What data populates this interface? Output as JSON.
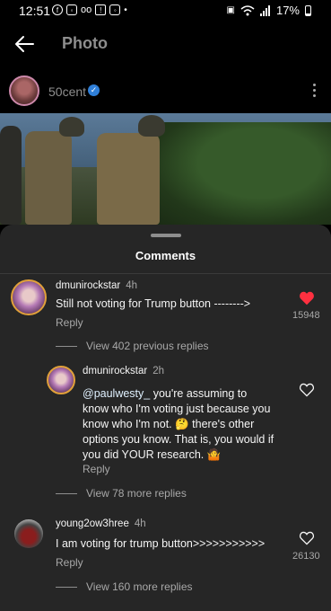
{
  "status_bar": {
    "time": "12:51",
    "battery": "17%"
  },
  "header": {
    "title": "Photo"
  },
  "post": {
    "author": "50cent"
  },
  "comments_sheet": {
    "title": "Comments",
    "comments": [
      {
        "username": "dmunirockstar",
        "time": "4h",
        "text": "Still not voting for Trump button -------->",
        "reply_label": "Reply",
        "likes": "15948",
        "liked": true,
        "view_replies": "View 402 previous replies"
      },
      {
        "username": "dmunirockstar",
        "time": "2h",
        "mention": "@paulwesty_",
        "text": " you're assuming to know who I'm voting just because you know who I'm not. 🤔 there's other options you know. That is, you would if you did YOUR research. 🤷",
        "reply_label": "Reply",
        "view_replies": "View 78 more replies"
      },
      {
        "username": "young2ow3hree",
        "time": "4h",
        "text": "I am voting for trump button>>>>>>>>>>>",
        "reply_label": "Reply",
        "likes": "26130",
        "liked": false,
        "view_replies": "View 160 more replies"
      }
    ]
  },
  "colors": {
    "background": "#000000",
    "sheet": "#262626",
    "like_red": "#ff3040",
    "verified_blue": "#2f7fd8"
  }
}
